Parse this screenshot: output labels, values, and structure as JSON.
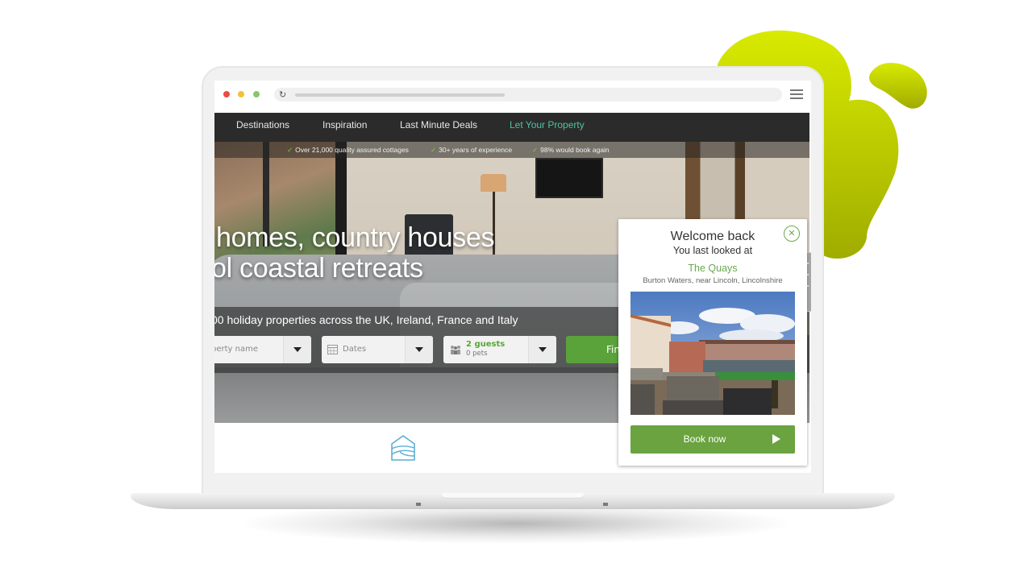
{
  "colors": {
    "accent_green": "#6aa340",
    "nav_accent": "#4ec3a3",
    "nav_background": "#2b2b2b",
    "blob_yellow": "#d4e600",
    "tick_green": "#7ccf3e",
    "icon_blue": "#5aaed8"
  },
  "browser": {
    "traffic_lights": [
      "close",
      "minimize",
      "maximize"
    ],
    "reload_icon": "reload-icon",
    "menu_icon": "hamburger-menu-icon"
  },
  "nav": {
    "items": [
      {
        "label": "Destinations"
      },
      {
        "label": "Inspiration"
      },
      {
        "label": "Last Minute Deals"
      },
      {
        "label": "Let Your Property"
      }
    ]
  },
  "trust_bar": {
    "items": [
      {
        "icon": "check",
        "label": "Over 21,000 quality assured cottages"
      },
      {
        "icon": "check",
        "label": "30+ years of experience"
      },
      {
        "icon": "check",
        "label": "98% would book again"
      }
    ]
  },
  "hero": {
    "headline_line1": "homes, country houses",
    "headline_line2": "ol coastal retreats",
    "subtitle": "00 holiday properties across the UK, Ireland, France and Italy"
  },
  "search": {
    "property_placeholder": "perty name",
    "dates_placeholder": "Dates",
    "guests_value": "2 guests",
    "pets_value": "0 pets",
    "find_label": "Find"
  },
  "popup": {
    "title": "Welcome back",
    "subtitle": "You last looked at",
    "property_name": "The Quays",
    "location": "Burton Waters, near Lincoln, Lincolnshire",
    "book_label": "Book now",
    "close_icon": "close-icon"
  }
}
